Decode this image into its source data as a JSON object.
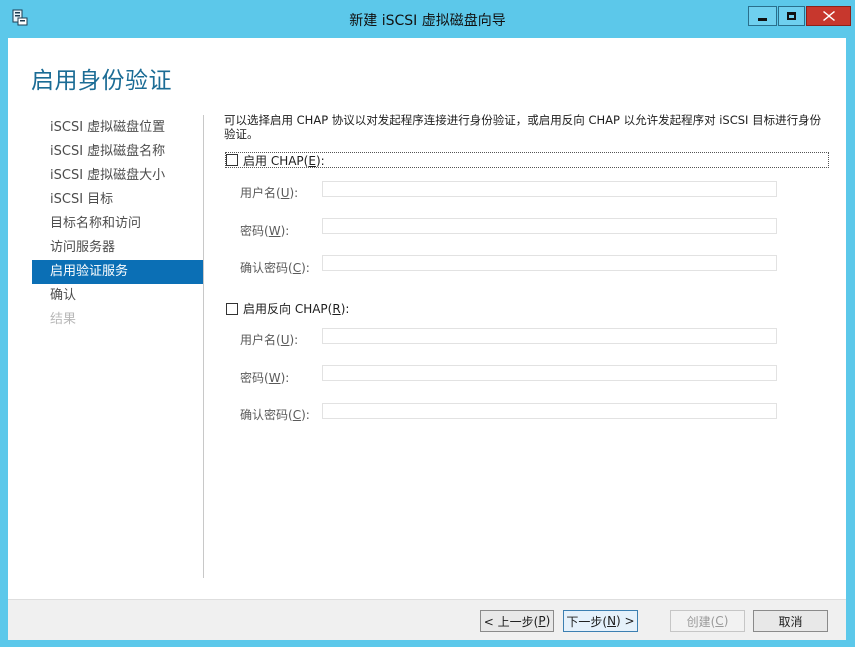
{
  "window": {
    "title": "新建 iSCSI 虚拟磁盘向导"
  },
  "page": {
    "title": "启用身份验证",
    "description": "可以选择启用 CHAP 协议以对发起程序连接进行身份验证，或启用反向 CHAP 以允许发起程序对 iSCSI 目标进行身份验证。"
  },
  "steps": [
    {
      "label": "iSCSI 虚拟磁盘位置",
      "state": "normal"
    },
    {
      "label": "iSCSI 虚拟磁盘名称",
      "state": "normal"
    },
    {
      "label": "iSCSI 虚拟磁盘大小",
      "state": "normal"
    },
    {
      "label": "iSCSI 目标",
      "state": "normal"
    },
    {
      "label": "目标名称和访问",
      "state": "normal"
    },
    {
      "label": "访问服务器",
      "state": "normal"
    },
    {
      "label": "启用验证服务",
      "state": "active"
    },
    {
      "label": "确认",
      "state": "normal"
    },
    {
      "label": "结果",
      "state": "disabled"
    }
  ],
  "chap": {
    "label_pre": "启用 CHAP(",
    "label_key": "E",
    "label_post": "):",
    "checked": false,
    "username": {
      "pre": "用户名(",
      "key": "U",
      "post": "):",
      "value": ""
    },
    "password": {
      "pre": "密码(",
      "key": "W",
      "post": "):",
      "value": ""
    },
    "confirm": {
      "pre": "确认密码(",
      "key": "C",
      "post": "):",
      "value": ""
    }
  },
  "reverse_chap": {
    "label_pre": "启用反向 CHAP(",
    "label_key": "R",
    "label_post": "):",
    "checked": false,
    "username": {
      "pre": "用户名(",
      "key": "U",
      "post": "):",
      "value": ""
    },
    "password": {
      "pre": "密码(",
      "key": "W",
      "post": "):",
      "value": ""
    },
    "confirm": {
      "pre": "确认密码(",
      "key": "C",
      "post": "):",
      "value": ""
    }
  },
  "buttons": {
    "prev": {
      "pre": "< 上一步(",
      "key": "P",
      "post": ")"
    },
    "next": {
      "pre": "下一步(",
      "key": "N",
      "post": ") >"
    },
    "create": {
      "pre": "创建(",
      "key": "C",
      "post": ")"
    },
    "cancel": "取消"
  }
}
